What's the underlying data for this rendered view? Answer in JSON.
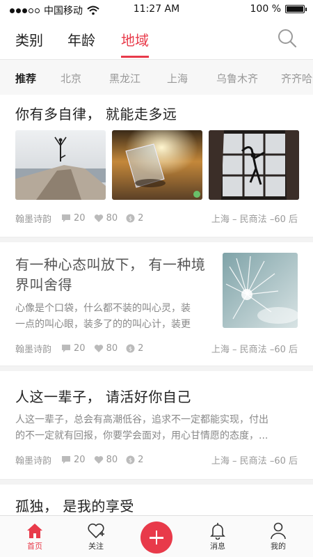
{
  "status_bar": {
    "carrier": "中国移动",
    "time": "11:27 AM",
    "battery_text": "100 %",
    "battery_level": 1.0
  },
  "top_tabs": [
    {
      "label": "类别",
      "active": false
    },
    {
      "label": "年龄",
      "active": false
    },
    {
      "label": "地域",
      "active": true
    }
  ],
  "search": {
    "icon": "search-icon"
  },
  "regions": [
    {
      "label": "推荐",
      "active": true
    },
    {
      "label": "北京",
      "active": false
    },
    {
      "label": "黑龙江",
      "active": false
    },
    {
      "label": "上海",
      "active": false
    },
    {
      "label": "乌鲁木齐",
      "active": false
    },
    {
      "label": "齐齐哈尔",
      "active": false
    }
  ],
  "articles": [
    {
      "title": "你有多自律， 就能走多远",
      "author": "翰墨诗韵",
      "comments": "20",
      "likes": "80",
      "coins": "2",
      "location": "上海 – 民商法 –60 后"
    },
    {
      "title_line1": "有一种心态叫放下， 有一种境",
      "title_line2": "界叫舍得",
      "snippet_line1": "心像是个口袋，什么都不装的叫心灵，装",
      "snippet_line2": "一点的叫心眼，装多了的的叫心计，装更",
      "author": "翰墨诗韵",
      "comments": "20",
      "likes": "80",
      "coins": "2",
      "location": "上海 – 民商法 –60 后"
    },
    {
      "title": "人这一辈子， 请活好你自己",
      "snippet_line1": "人这一辈子，总会有高潮低谷，追求不一定都能实现，付出",
      "snippet_line2": "的不一定就有回报，你要学会面对，用心甘情愿的态度，...",
      "author": "翰墨诗韵",
      "comments": "20",
      "likes": "80",
      "coins": "2",
      "location": "上海 – 民商法 –60 后"
    },
    {
      "title": "孤独， 是我的享受"
    }
  ],
  "bottom_nav": {
    "home": "首页",
    "follow": "关注",
    "messages": "消息",
    "mine": "我的"
  },
  "colors": {
    "accent": "#e83a4a",
    "muted": "#999999"
  }
}
